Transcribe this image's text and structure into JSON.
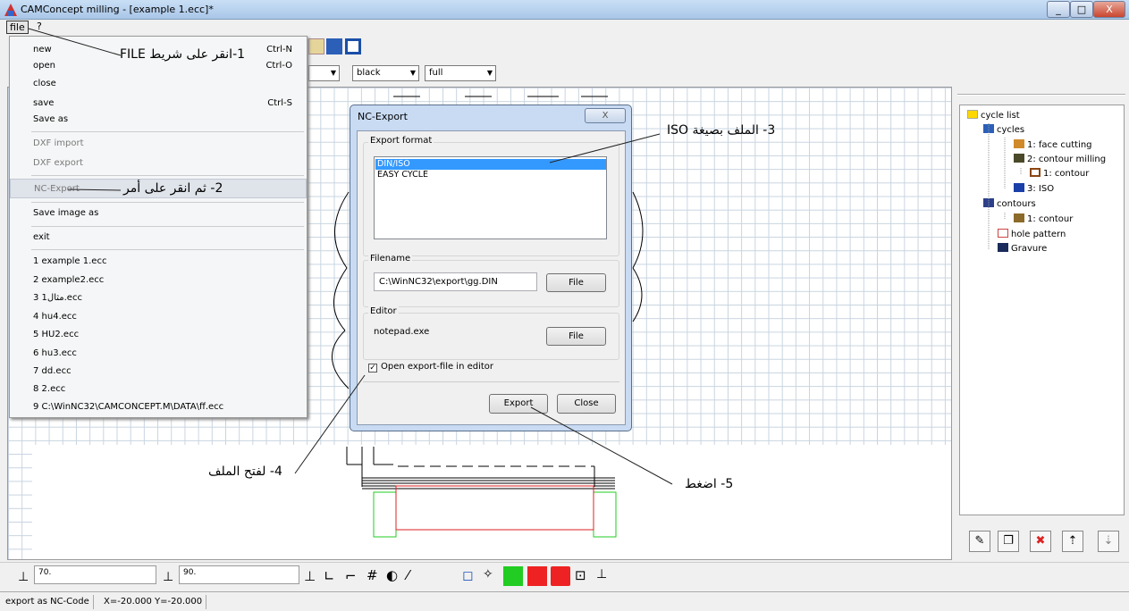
{
  "window": {
    "title": "CAMConcept milling - [example 1.ecc]*",
    "controls": [
      "_",
      "□",
      "X"
    ]
  },
  "menubar": {
    "items": [
      {
        "label": "file"
      },
      {
        "label": "?"
      }
    ]
  },
  "toolbar2": {
    "combo2": "black",
    "combo3": "full"
  },
  "file_menu": {
    "items": [
      {
        "label": "new",
        "shortcut": "Ctrl-N"
      },
      {
        "label": "open",
        "shortcut": "Ctrl-O"
      },
      {
        "label": "close",
        "shortcut": ""
      },
      {
        "label": "save",
        "shortcut": "Ctrl-S"
      },
      {
        "label": "Save as",
        "shortcut": ""
      },
      {
        "label": "DXF import",
        "shortcut": ""
      },
      {
        "label": "DXF export",
        "shortcut": ""
      },
      {
        "label": "NC-Export",
        "shortcut": ""
      },
      {
        "label": "Save image as",
        "shortcut": ""
      },
      {
        "label": "exit",
        "shortcut": ""
      },
      {
        "label": "1 example 1.ecc",
        "shortcut": ""
      },
      {
        "label": "2 example2.ecc",
        "shortcut": ""
      },
      {
        "label": "3 مثال1.ecc",
        "shortcut": ""
      },
      {
        "label": "4 hu4.ecc",
        "shortcut": ""
      },
      {
        "label": "5 HU2.ecc",
        "shortcut": ""
      },
      {
        "label": "6 hu3.ecc",
        "shortcut": ""
      },
      {
        "label": "7 dd.ecc",
        "shortcut": ""
      },
      {
        "label": "8 2.ecc",
        "shortcut": ""
      },
      {
        "label": "9 C:\\WinNC32\\CAMCONCEPT.M\\DATA\\ff.ecc",
        "shortcut": ""
      }
    ]
  },
  "dialog": {
    "title": "NC-Export",
    "close_label": "X",
    "export_format_label": "Export format",
    "formats": [
      "DIN/ISO",
      "EASY CYCLE"
    ],
    "selected_format": "DIN/ISO",
    "filename_label": "Filename",
    "filename_value": "C:\\WinNC32\\export\\gg.DIN",
    "file_button": "File",
    "editor_label": "Editor",
    "editor_value": "notepad.exe",
    "editor_file_button": "File",
    "open_in_editor_label": "Open export-file in editor",
    "open_in_editor_checked": true,
    "export_button": "Export",
    "close_button": "Close"
  },
  "tree": {
    "nodes": [
      {
        "label": "cycle list",
        "icon": "folder-icon"
      },
      {
        "label": "cycles",
        "icon": "cycles-icon"
      },
      {
        "label": "1: face cutting",
        "icon": "face-cutting-icon"
      },
      {
        "label": "2: contour milling",
        "icon": "contour-milling-icon"
      },
      {
        "label": "1: contour",
        "icon": "contour-icon"
      },
      {
        "label": "3: ISO",
        "icon": "iso-icon"
      },
      {
        "label": "contours",
        "icon": "contours-icon"
      },
      {
        "label": "1: contour",
        "icon": "contour-icon"
      },
      {
        "label": "hole pattern",
        "icon": "hole-pattern-icon"
      },
      {
        "label": "Gravure",
        "icon": "gravure-icon"
      }
    ]
  },
  "coords": {
    "x_value": "70.",
    "y_value": "90."
  },
  "status": {
    "message": "export as NC-Code",
    "position": "X=-20.000 Y=-20.000"
  },
  "annotations": {
    "step1": "1-انقر على شريط FILE",
    "step2": "2- ثم انقر على أمر",
    "step3": "3- الملف بصيغة ISO",
    "step4": "4- لفتح الملف",
    "step5": "5- اضغط"
  },
  "colors": {
    "selection": "#3399ff",
    "grid": "#c8d4e0",
    "titlebar": "#a9c6e8"
  }
}
